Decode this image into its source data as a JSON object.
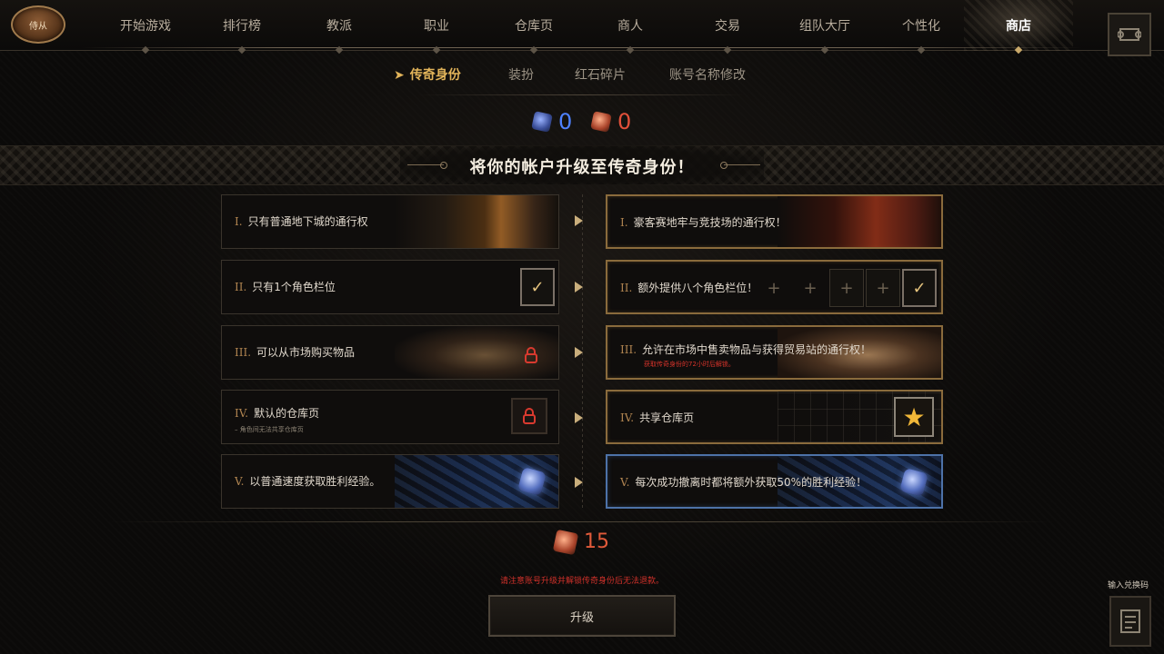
{
  "badge": {
    "label": "侍从"
  },
  "nav": {
    "items": [
      {
        "label": "开始游戏"
      },
      {
        "label": "排行榜"
      },
      {
        "label": "教派"
      },
      {
        "label": "职业"
      },
      {
        "label": "仓库页"
      },
      {
        "label": "商人"
      },
      {
        "label": "交易"
      },
      {
        "label": "组队大厅"
      },
      {
        "label": "个性化"
      },
      {
        "label": "商店",
        "active": true
      }
    ]
  },
  "subtabs": [
    {
      "label": "传奇身份",
      "active": true
    },
    {
      "label": "装扮"
    },
    {
      "label": "红石碎片"
    },
    {
      "label": "账号名称修改"
    }
  ],
  "currency": {
    "blue": {
      "value": "0",
      "color": "#4f82ff"
    },
    "red": {
      "value": "0",
      "color": "#e0503a"
    }
  },
  "banner": {
    "title": "将你的帐户升级至传奇身份！"
  },
  "rows": [
    {
      "left": {
        "roman": "I.",
        "text": "只有普通地下城的通行权"
      },
      "right": {
        "roman": "I.",
        "text": "豪客赛地牢与竞技场的通行权！"
      }
    },
    {
      "left": {
        "roman": "II.",
        "text": "只有1个角色栏位",
        "check": "✓"
      },
      "right": {
        "roman": "II.",
        "text": "额外提供八个角色栏位！",
        "slots": [
          "+",
          "+",
          "+",
          "+",
          "✓"
        ]
      }
    },
    {
      "left": {
        "roman": "III.",
        "text": "可以从市场购买物品"
      },
      "right": {
        "roman": "III.",
        "text": "允许在市场中售卖物品与获得贸易站的通行权！",
        "note": "获取传奇身份的72小时后解锁。"
      }
    },
    {
      "left": {
        "roman": "IV.",
        "text": "默认的仓库页",
        "sub": "– 角色间无法共享仓库页"
      },
      "right": {
        "roman": "IV.",
        "text": "共享仓库页",
        "star": "★"
      }
    },
    {
      "left": {
        "roman": "V.",
        "text": "以普通速度获取胜利经验。"
      },
      "right": {
        "roman": "V.",
        "text": "每次成功撤离时都将额外获取50%的胜利经验！"
      }
    }
  ],
  "cost": {
    "value": "15"
  },
  "warning": "请注意账号升级并解锁传奇身份后无法退款。",
  "upgrade_button": "升级",
  "redeem": {
    "label": "输入兑换码"
  },
  "colors": {
    "accent": "#e2b45a",
    "gold_border": "#8a6b3c",
    "blue_border": "#4d72a8",
    "warning": "#d0312a"
  }
}
